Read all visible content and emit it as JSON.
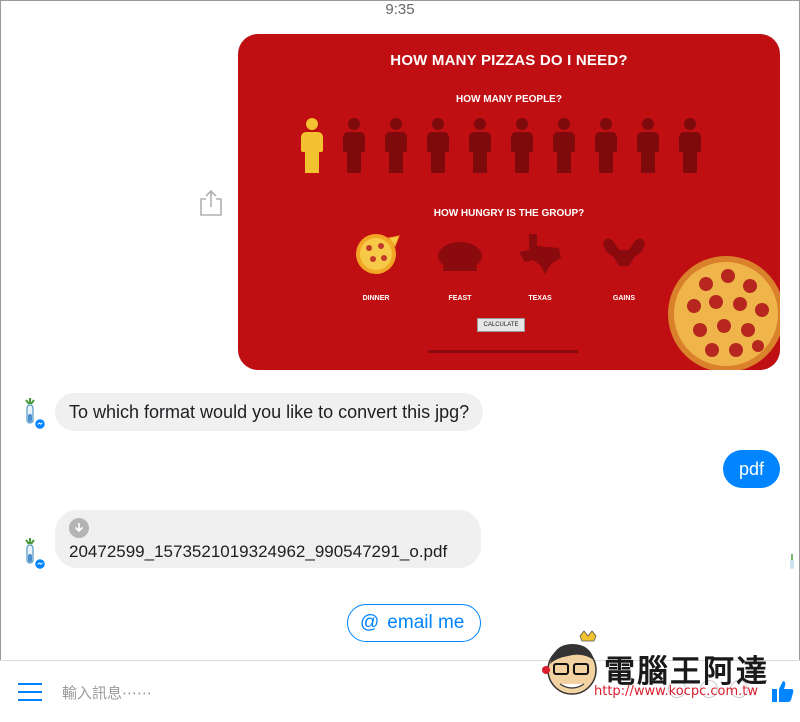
{
  "status_bar": {
    "time": "9:35"
  },
  "image_card": {
    "title": "HOW MANY PIZZAS DO I NEED?",
    "question_people": "HOW MANY PEOPLE?",
    "people_selected": 1,
    "people_max": 10,
    "question_hunger": "HOW HUNGRY IS THE GROUP?",
    "hunger_options": [
      "DINNER",
      "FEAST",
      "TEXAS",
      "GAINS"
    ],
    "calculate_label": "CALCULATE",
    "colors": {
      "background": "#c00f12",
      "selected": "#f2c230",
      "unselected": "#7e0a0c"
    }
  },
  "messages": {
    "bot_question": "To which format would you like to convert this jpg?",
    "user_reply": "pdf",
    "file_name": "20472599_1573521019324962_990547291_o.pdf"
  },
  "quick_reply": {
    "at": "@",
    "label": "email me"
  },
  "composer": {
    "placeholder": "輸入訊息⋯⋯"
  },
  "watermark": {
    "title": "電腦王阿達",
    "url": "http://www.kocpc.com.tw"
  },
  "colors": {
    "accent": "#0084ff",
    "incoming_bubble": "#f1f0f0"
  }
}
